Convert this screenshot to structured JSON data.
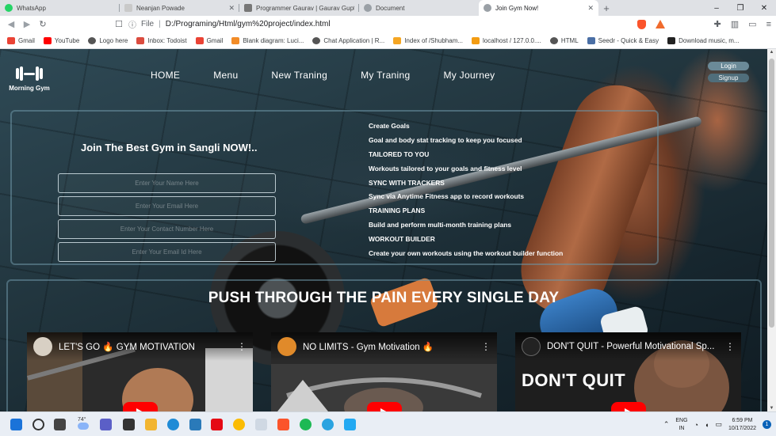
{
  "browser": {
    "tabs": [
      {
        "title": "WhatsApp",
        "color": "#25d366",
        "active": false
      },
      {
        "title": "Neanjan Powade",
        "color": "#c9c9c9",
        "active": false
      },
      {
        "title": "Programmer Gaurav | Gaurav Gupta |",
        "color": "#777777",
        "active": false
      },
      {
        "title": "Document",
        "color": "#9aa0a6",
        "active": false
      },
      {
        "title": "Join Gym Now!",
        "color": "#9aa0a6",
        "active": true
      }
    ],
    "new_tab": "+",
    "window_controls": {
      "minimize": "–",
      "maximize": "❐",
      "close": "✕"
    },
    "address": {
      "scheme_label": "File",
      "url": "D:/Programing/Html/gym%20project/index.html"
    },
    "bookmarks": [
      {
        "label": "Gmail",
        "color": "#ea4335"
      },
      {
        "label": "YouTube",
        "color": "#ff0000"
      },
      {
        "label": "Logo here",
        "color": "#555555"
      },
      {
        "label": "Inbox: Todoist",
        "color": "#db4c3f"
      },
      {
        "label": "Gmail",
        "color": "#ea4335"
      },
      {
        "label": "Blank diagram: Luci...",
        "color": "#f28c28"
      },
      {
        "label": "Chat Application | R...",
        "color": "#555555"
      },
      {
        "label": "Index of /Shubham...",
        "color": "#f5a623"
      },
      {
        "label": "localhost / 127.0.0....",
        "color": "#f39c12"
      },
      {
        "label": "HTML",
        "color": "#555555"
      },
      {
        "label": "Seedr - Quick & Easy",
        "color": "#4a6fa5"
      },
      {
        "label": "Download music, m...",
        "color": "#222222"
      }
    ]
  },
  "site": {
    "brand": "Morning Gym",
    "nav": [
      "HOME",
      "Menu",
      "New Traning",
      "My Traning",
      "My Journey"
    ],
    "auth": {
      "login": "Login",
      "signup": "Signup"
    },
    "join": {
      "title": "Join The Best Gym in Sangli NOW!..",
      "fields": [
        {
          "placeholder": "Enter Your Name Here"
        },
        {
          "placeholder": "Enter Your Email Here"
        },
        {
          "placeholder": "Enter Your Contact Number Here"
        },
        {
          "placeholder": "Enter Your Email Id Here"
        }
      ]
    },
    "features": [
      "Create Goals",
      "Goal and body stat tracking to keep you focused",
      "TAILORED TO YOU",
      "Workouts tailored to your goals and fitness level",
      "SYNC WITH TRACKERS",
      "Sync via Anytime Fitness app to record workouts",
      "TRAINING PLANS",
      "Build and perform multi-month training plans",
      "WORKOUT BUILDER",
      "Create your own workouts using the workout builder function"
    ],
    "headline": "PUSH THROUGH THE PAIN EVERY SINGLE DAY",
    "videos": [
      {
        "title": "LET'S GO 🔥 GYM MOTIVATION",
        "overlay": ""
      },
      {
        "title": "NO LIMITS - Gym Motivation 🔥",
        "overlay": ""
      },
      {
        "title": "DON'T QUIT - Powerful Motivational Sp...",
        "overlay": "DON'T QUIT"
      }
    ]
  },
  "taskbar": {
    "weather": "74°",
    "lang": {
      "line1": "ENG",
      "line2": "IN"
    },
    "clock": {
      "time": "6:59 PM",
      "date": "10/17/2022"
    },
    "notifications": "1"
  }
}
